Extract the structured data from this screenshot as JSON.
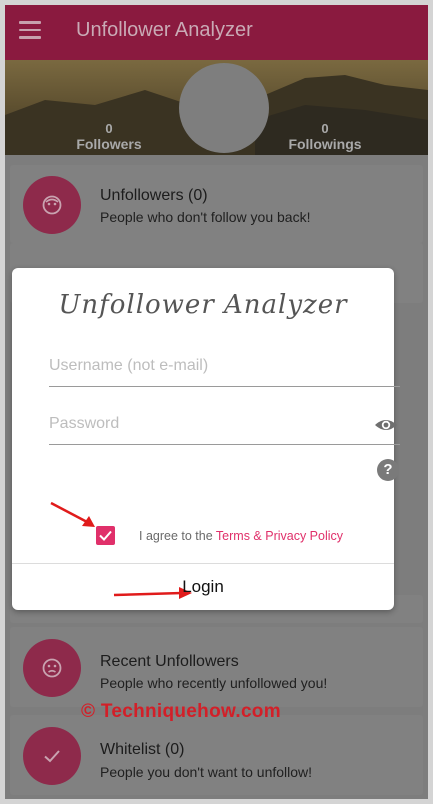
{
  "app": {
    "title": "Unfollower Analyzer",
    "brand_color": "#8a1a3f",
    "accent_color": "#e0306a"
  },
  "header": {
    "followers": {
      "count": "0",
      "label": "Followers"
    },
    "followings": {
      "count": "0",
      "label": "Followings"
    }
  },
  "cards": [
    {
      "icon": "face-icon",
      "title": "Unfollowers (0)",
      "subtitle": "People who don't follow you back!"
    },
    {
      "icon": "sad-face-icon",
      "title": "Recent Unfollowers",
      "subtitle": "People who recently unfollowed you!"
    },
    {
      "icon": "check-icon",
      "title": "Whitelist (0)",
      "subtitle": "People you don't want to unfollow!"
    }
  ],
  "dialog": {
    "title": "Unfollower Analyzer",
    "username": {
      "value": "",
      "placeholder": "Username (not e-mail)"
    },
    "password": {
      "value": "",
      "placeholder": "Password"
    },
    "agree_prefix": "I agree to the",
    "agree_link": "Terms & Privacy Policy",
    "agree_checked": true,
    "login_label": "Login"
  },
  "watermark": "© Techniquehow.com"
}
